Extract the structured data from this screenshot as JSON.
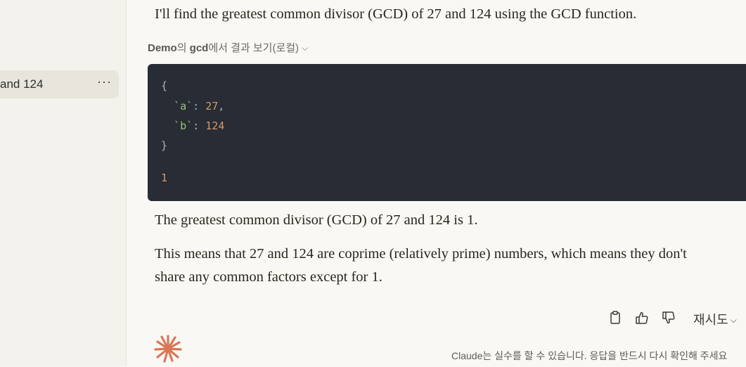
{
  "sidebar": {
    "active_conversation": {
      "title": "and 124",
      "more_label": "···"
    }
  },
  "message": {
    "intro": "I'll find the greatest common divisor (GCD) of 27 and 124 using the GCD function.",
    "tool_call": {
      "server": "Demo",
      "connector_1": "의 ",
      "tool": "gcd",
      "connector_2": "에서 결과 보기(로컬)",
      "chevron": "⌵"
    },
    "code": {
      "open_brace": "{",
      "key_a": "a",
      "val_a": "27",
      "key_b": "b",
      "val_b": "124",
      "close_brace": "}",
      "result": "1"
    },
    "answer": "The greatest common divisor (GCD) of 27 and 124 is 1.",
    "explanation": "This means that 27 and 124 are coprime (relatively prime) numbers, which means they don't share any common factors except for 1."
  },
  "actions": {
    "copy_icon": "clipboard-icon",
    "thumbs_up_icon": "thumbs-up-icon",
    "thumbs_down_icon": "thumbs-down-icon",
    "retry_label": "재시도",
    "retry_chevron": "⌵"
  },
  "footer": {
    "disclaimer": "Claude는 실수를 할 수 있습니다. 응답을 반드시 다시 확인해 주세요"
  },
  "colors": {
    "accent": "#d97757",
    "code_bg": "#282c34",
    "page_bg": "#f9f8f4",
    "sidebar_bg": "#f4f2ec"
  }
}
